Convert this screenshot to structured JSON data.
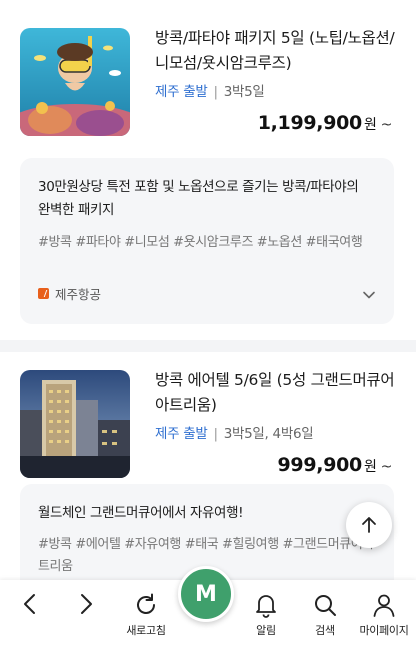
{
  "products": [
    {
      "title": "방콕/파타야 패키지 5일 (노팁/노옵션/니모섬/욧시암크루즈)",
      "departure": "제주 출발",
      "duration": "3박5일",
      "price": "1,199,900",
      "currency": "원",
      "price_suffix": "~",
      "promo_title": "30만원상당 특전 포함 및 노옵션으로 즐기는 방콕/파타야의 완벽한 패키지",
      "tags": "#방콕 #파타야 #니모섬 #욧시암크루즈 #노옵션 #태국여행",
      "airline": "제주항공",
      "image_desc": "snorkeling-photo"
    },
    {
      "title": "방콕 에어텔 5/6일 (5성 그랜드머큐어아트리움)",
      "departure": "제주 출발",
      "duration": "3박5일, 4박6일",
      "price": "999,900",
      "currency": "원",
      "price_suffix": "~",
      "promo_title": "월드체인 그랜드머큐어에서 자유여행!",
      "tags": "#방콕 #에어텔 #자유여행 #태국 #힐링여행 #그랜드머큐어아트리움",
      "image_desc": "hotel-photo"
    }
  ],
  "bottom_nav": {
    "refresh_label": "새로고침",
    "home_label": "M",
    "alert_label": "알림",
    "search_label": "검색",
    "mypage_label": "마이페이지"
  },
  "colors": {
    "accent_blue": "#2f6fd0",
    "home_green": "#3fa06c",
    "airline_orange": "#e8601c",
    "promo_bg": "#f5f6f8"
  }
}
